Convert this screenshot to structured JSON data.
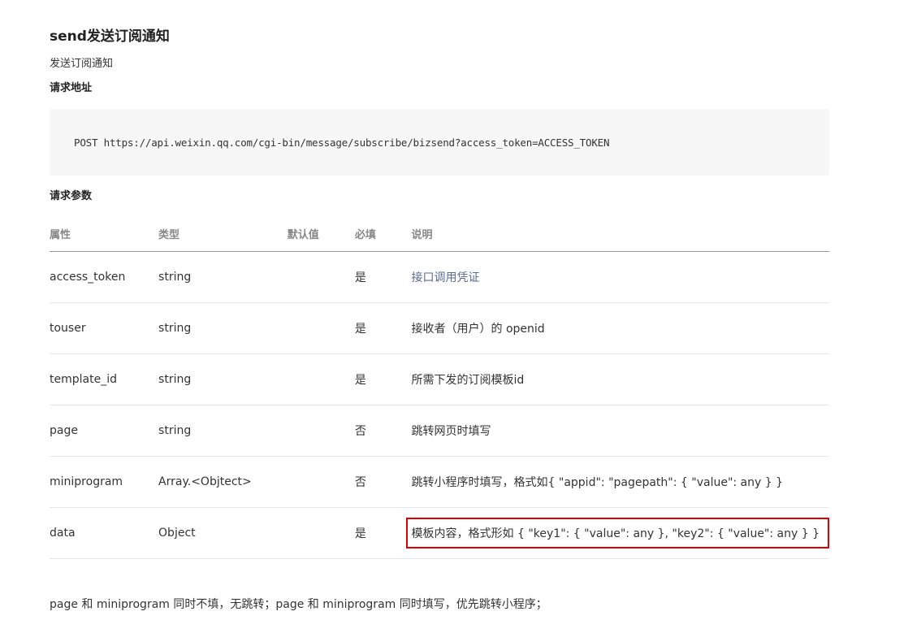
{
  "doc": {
    "title": "send发送订阅通知",
    "subtitle": "发送订阅通知",
    "request_url_heading": "请求地址",
    "request_url": "POST https://api.weixin.qq.com/cgi-bin/message/subscribe/bizsend?access_token=ACCESS_TOKEN",
    "params_heading": "请求参数",
    "footer_note": "page 和 miniprogram 同时不填，无跳转；page 和 miniprogram 同时填写，优先跳转小程序；"
  },
  "table": {
    "headers": [
      "属性",
      "类型",
      "默认值",
      "必填",
      "说明"
    ],
    "rows": [
      {
        "name": "access_token",
        "type": "string",
        "default": "",
        "required": "是",
        "desc": "接口调用凭证"
      },
      {
        "name": "touser",
        "type": "string",
        "default": "",
        "required": "是",
        "desc": "接收者（用户）的 openid"
      },
      {
        "name": "template_id",
        "type": "string",
        "default": "",
        "required": "是",
        "desc": "所需下发的订阅模板id"
      },
      {
        "name": "page",
        "type": "string",
        "default": "",
        "required": "否",
        "desc": "跳转网页时填写"
      },
      {
        "name": "miniprogram",
        "type": "Array.<Objtect>",
        "default": "",
        "required": "否",
        "desc": "跳转小程序时填写，格式如{ \"appid\": \"pagepath\": { \"value\": any } }"
      },
      {
        "name": "data",
        "type": "Object",
        "default": "",
        "required": "是",
        "desc": "模板内容，格式形如 { \"key1\": { \"value\": any }, \"key2\": { \"value\": any } }"
      }
    ]
  },
  "colors": {
    "link": "#576b95",
    "highlight_border": "#e00000",
    "code_background": "#f7f7f7"
  }
}
